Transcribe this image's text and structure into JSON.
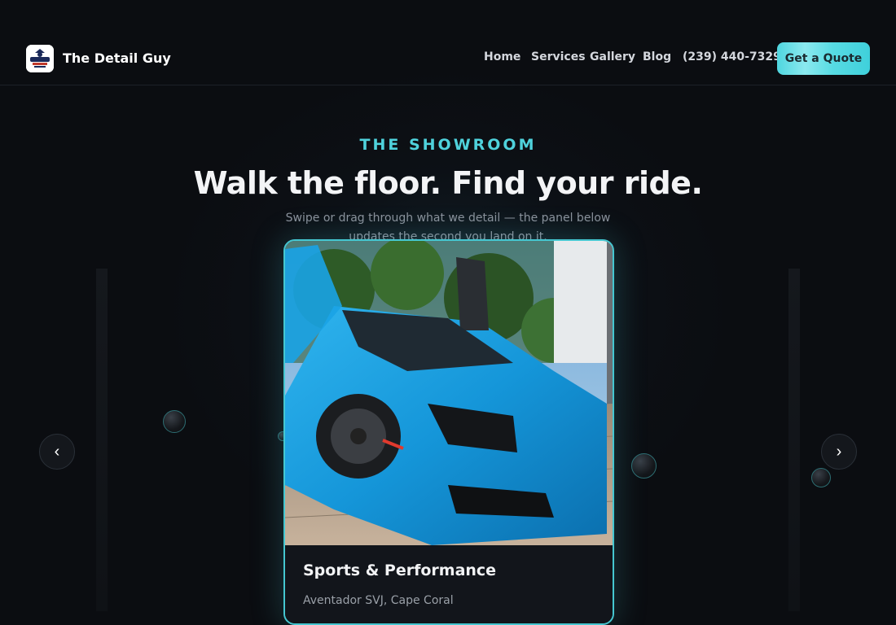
{
  "nav": {
    "brand": "The Detail Guy",
    "links": [
      "Home",
      "Services",
      "Gallery",
      "Blog",
      "(239) 440-7329"
    ],
    "cta": "Get a Quote"
  },
  "hero": {
    "eyebrow": "THE SHOWROOM",
    "headline": "Walk the floor. Find your ride.",
    "subtext": "Swipe or drag through what we detail — the panel below updates the second you land on it."
  },
  "carousel": {
    "prev_icon": "chevron-left-icon",
    "next_icon": "chevron-right-icon",
    "prev_glyph": "‹",
    "next_glyph": "›",
    "active_card": {
      "title": "Sports & Performance",
      "subtitle": "Aventador SVJ, Cape Coral"
    }
  },
  "colors": {
    "accent": "#4fd2dc",
    "background": "#0b0d11",
    "card_border": "#45c7d1"
  }
}
